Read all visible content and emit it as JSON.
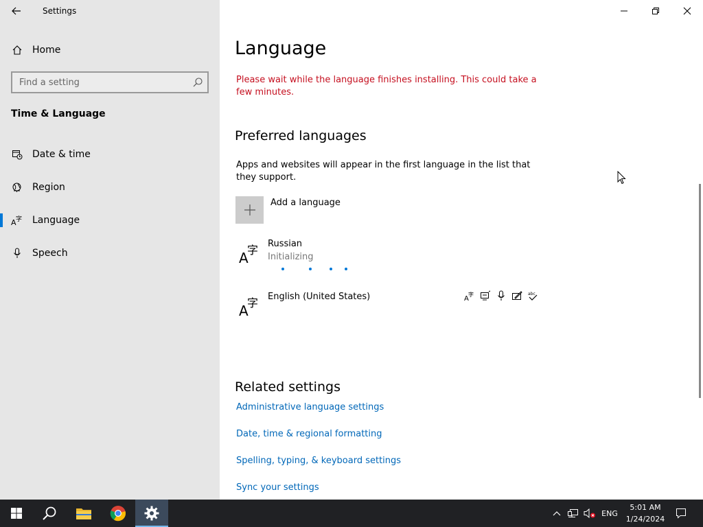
{
  "app": {
    "title": "Settings"
  },
  "sidebar": {
    "home_label": "Home",
    "search_placeholder": "Find a setting",
    "section_title": "Time & Language",
    "items": [
      {
        "label": "Date & time",
        "icon": "calendar-clock-icon"
      },
      {
        "label": "Region",
        "icon": "globe-icon"
      },
      {
        "label": "Language",
        "icon": "language-icon",
        "active": true
      },
      {
        "label": "Speech",
        "icon": "microphone-icon"
      }
    ]
  },
  "main": {
    "title": "Language",
    "warning": "Please wait while the language finishes installing. This could take a few minutes.",
    "preferred_heading": "Preferred languages",
    "preferred_desc": "Apps and websites will appear in the first language in the list that they support.",
    "add_language_label": "Add a language",
    "languages": [
      {
        "name": "Russian",
        "status": "Initializing"
      },
      {
        "name": "English (United States)",
        "features": [
          "display-language-icon",
          "text-to-speech-icon",
          "speech-recognition-icon",
          "handwriting-icon",
          "spell-check-icon"
        ]
      }
    ],
    "related_heading": "Related settings",
    "related_links": [
      "Administrative language settings",
      "Date, time & regional formatting",
      "Spelling, typing, & keyboard settings",
      "Sync your settings"
    ]
  },
  "taskbar": {
    "apps": [
      "start-icon",
      "search-icon",
      "file-explorer-icon",
      "chrome-icon",
      "settings-icon"
    ],
    "input_language": "ENG",
    "time": "5:01 AM",
    "date": "1/24/2024"
  },
  "colors": {
    "accent": "#0078d7",
    "warning": "#c50f1f",
    "link": "#0067b8",
    "sidebar_bg": "#e6e6e6",
    "taskbar_bg": "#202124"
  }
}
